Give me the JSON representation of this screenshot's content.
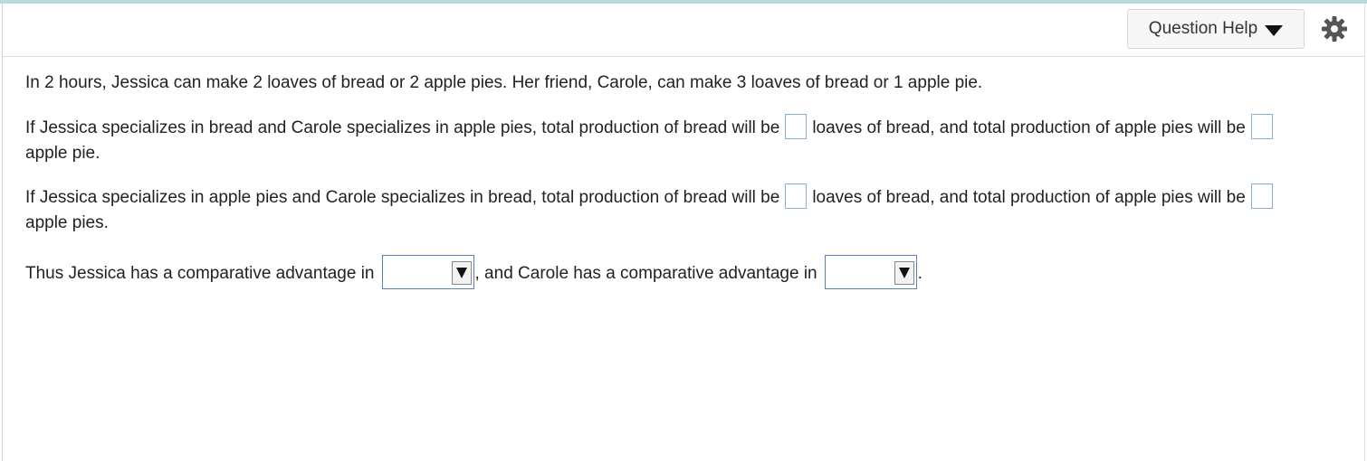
{
  "header": {
    "question_help_label": "Question Help",
    "settings_icon": "gear-icon"
  },
  "question": {
    "intro": "In 2 hours, Jessica can make 2 loaves of bread or 2 apple pies. Her friend, Carole, can make 3 loaves of bread or 1 apple pie.",
    "q1": {
      "part_a": "If Jessica specializes in bread and Carole specializes in apple pies, total production of bread will be",
      "part_b": "loaves of bread, and total production of apple pies will be",
      "part_c": "apple pie."
    },
    "q2": {
      "part_a": "If Jessica specializes in apple pies and Carole specializes in bread, total production of bread will be",
      "part_b": "loaves of bread, and total production of apple pies will be",
      "part_c": "apple pies."
    },
    "q3": {
      "part_a": "Thus Jessica has a comparative advantage in",
      "part_b": ", and Carole has a comparative advantage in",
      "part_c": ".",
      "dropdown1_value": "",
      "dropdown2_value": ""
    }
  },
  "colors": {
    "top_accent": "#b9dcd8",
    "input_border": "#8aaed0",
    "dropdown_border": "#5b7fb8"
  }
}
